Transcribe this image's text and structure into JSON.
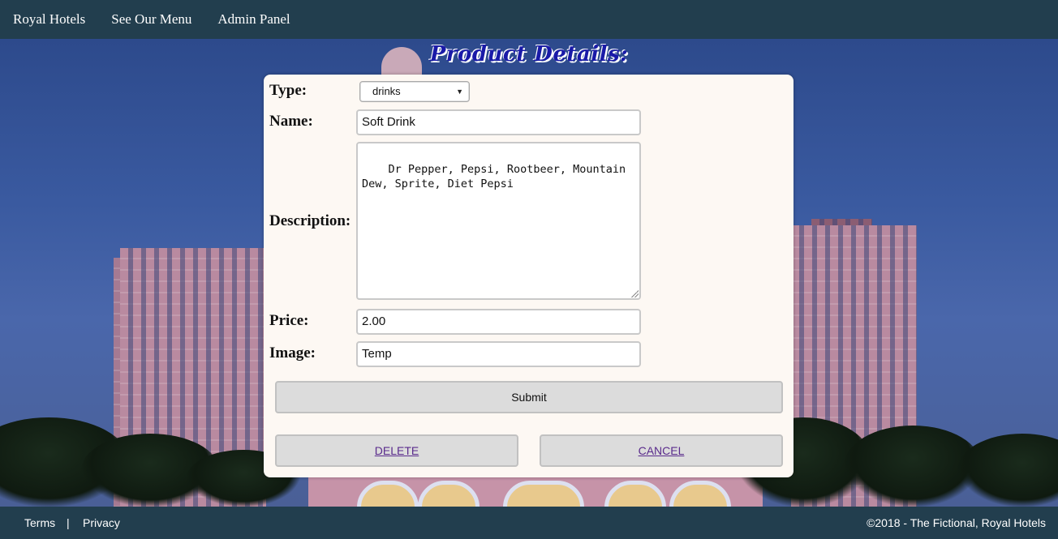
{
  "nav": {
    "items": [
      {
        "label": "Royal Hotels"
      },
      {
        "label": "See Our Menu"
      },
      {
        "label": "Admin Panel"
      }
    ]
  },
  "page": {
    "heading": "Product Details:"
  },
  "form": {
    "type_label": "Type:",
    "type_value": "drinks",
    "name_label": "Name:",
    "name_value": "Soft Drink",
    "description_label": "Description:",
    "description_value": "Dr Pepper, Pepsi, Rootbeer, Mountain Dew, Sprite, Diet Pepsi",
    "price_label": "Price:",
    "price_value": "2.00",
    "image_label": "Image:",
    "image_value": "Temp",
    "submit_label": "Submit",
    "delete_label": "DELETE",
    "cancel_label": "CANCEL"
  },
  "footer": {
    "terms": "Terms",
    "separator": "|",
    "privacy": "Privacy",
    "copyright": "©2018 - The Fictional, Royal Hotels"
  },
  "colors": {
    "nav_bg": "#223e4e",
    "heading": "#1a1aa8",
    "card_bg": "#fdf8f3",
    "link_visited": "#5a2b8c"
  },
  "icons": {
    "select_arrow": "caret-down-icon"
  }
}
